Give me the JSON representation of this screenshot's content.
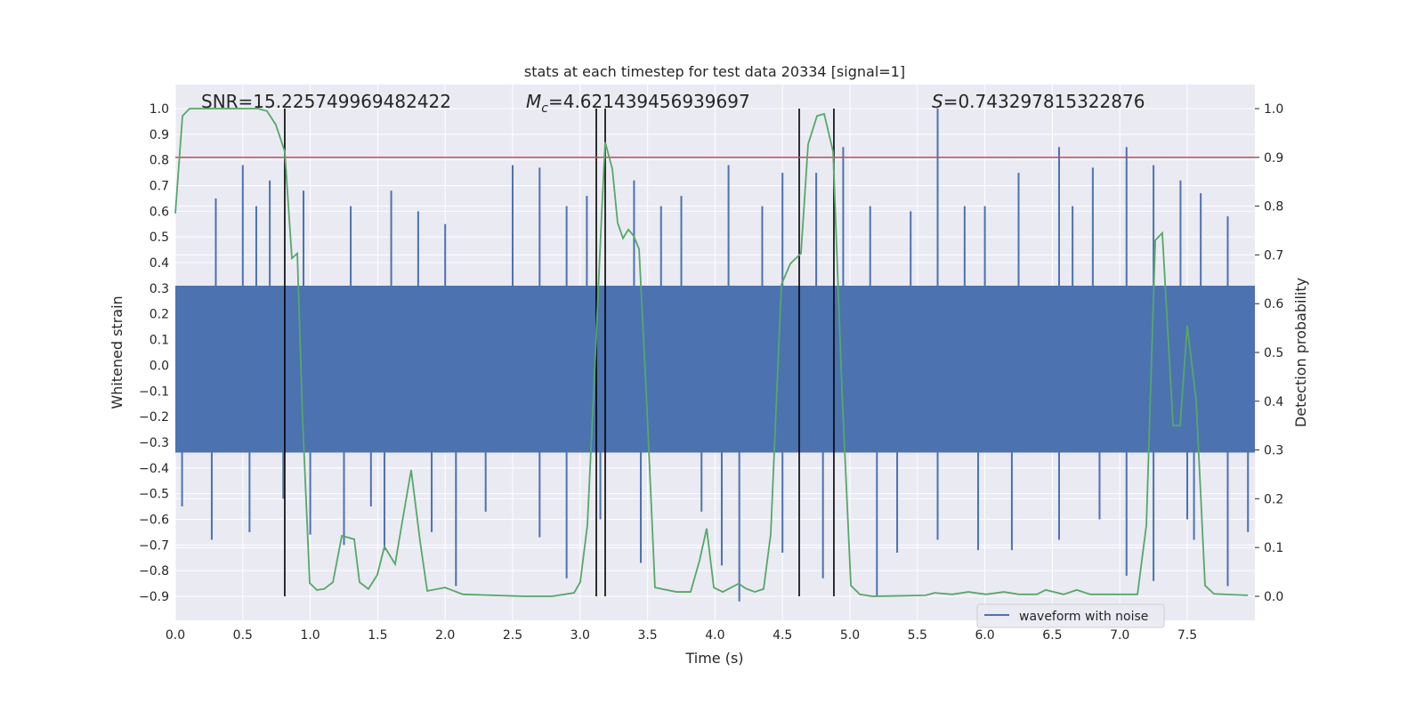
{
  "chart_data": {
    "type": "line",
    "title": "stats at each timestep for test data 20334 [signal=1]",
    "xlabel": "Time (s)",
    "ylabel": "Whitened strain",
    "ylabel_right": "Detection probability",
    "xlim": [
      0.0,
      8.0
    ],
    "ylim": [
      -0.99,
      1.09
    ],
    "ylim_right": [
      -0.05,
      1.05
    ],
    "grid": true,
    "legend_position": "lower-right",
    "x_ticks": [
      "0.0",
      "0.5",
      "1.0",
      "1.5",
      "2.0",
      "2.5",
      "3.0",
      "3.5",
      "4.0",
      "4.5",
      "5.0",
      "5.5",
      "6.0",
      "6.5",
      "7.0",
      "7.5"
    ],
    "y_ticks": [
      "1.0",
      "0.9",
      "0.8",
      "0.7",
      "0.6",
      "0.5",
      "0.4",
      "0.3",
      "0.2",
      "0.1",
      "0.0",
      "−0.1",
      "−0.2",
      "−0.3",
      "−0.4",
      "−0.5",
      "−0.6",
      "−0.7",
      "−0.8",
      "−0.9"
    ],
    "y_ticks_right": [
      "1.0",
      "0.9",
      "0.8",
      "0.7",
      "0.6",
      "0.5",
      "0.4",
      "0.3",
      "0.2",
      "0.1",
      "0.0"
    ],
    "annotations": {
      "snr": "SNR=15.225749969482422",
      "mc_symbol": "M",
      "mc_sub": "c",
      "mc_value": "=4.621439456939697",
      "s_symbol": "S",
      "s_value": "=0.743297815322876"
    },
    "colors": {
      "waveform": "#4c72b0",
      "probability": "#55a868",
      "threshold": "#c44e52",
      "markers": "#000000",
      "background": "#eaeaf2"
    },
    "waveform": {
      "name": "waveform with noise",
      "core_range": [
        -0.34,
        0.31
      ],
      "spikes": [
        [
          0.05,
          -0.55
        ],
        [
          0.27,
          -0.68
        ],
        [
          0.3,
          0.65
        ],
        [
          0.5,
          0.78
        ],
        [
          0.55,
          -0.65
        ],
        [
          0.6,
          0.62
        ],
        [
          0.7,
          0.72
        ],
        [
          0.8,
          -0.52
        ],
        [
          0.95,
          0.68
        ],
        [
          1.0,
          -0.66
        ],
        [
          1.25,
          -0.7
        ],
        [
          1.3,
          0.62
        ],
        [
          1.45,
          -0.55
        ],
        [
          1.55,
          -0.72
        ],
        [
          1.6,
          0.68
        ],
        [
          1.8,
          0.6
        ],
        [
          1.9,
          -0.65
        ],
        [
          2.0,
          0.55
        ],
        [
          2.08,
          -0.86
        ],
        [
          2.3,
          -0.57
        ],
        [
          2.5,
          0.78
        ],
        [
          2.7,
          0.77
        ],
        [
          2.7,
          -0.67
        ],
        [
          2.9,
          0.62
        ],
        [
          2.9,
          -0.83
        ],
        [
          3.05,
          0.66
        ],
        [
          3.15,
          -0.6
        ],
        [
          3.4,
          0.72
        ],
        [
          3.45,
          -0.77
        ],
        [
          3.6,
          0.62
        ],
        [
          3.75,
          0.66
        ],
        [
          3.9,
          -0.57
        ],
        [
          4.05,
          -0.78
        ],
        [
          4.1,
          0.78
        ],
        [
          4.18,
          -0.92
        ],
        [
          4.35,
          0.62
        ],
        [
          4.5,
          0.75
        ],
        [
          4.5,
          -0.73
        ],
        [
          4.75,
          0.75
        ],
        [
          4.8,
          -0.83
        ],
        [
          4.95,
          0.85
        ],
        [
          5.15,
          0.62
        ],
        [
          5.2,
          -0.9
        ],
        [
          5.35,
          -0.73
        ],
        [
          5.45,
          0.6
        ],
        [
          5.65,
          1.0
        ],
        [
          5.65,
          -0.68
        ],
        [
          5.85,
          0.62
        ],
        [
          5.95,
          -0.72
        ],
        [
          6.0,
          0.62
        ],
        [
          6.2,
          -0.72
        ],
        [
          6.25,
          0.75
        ],
        [
          6.55,
          0.85
        ],
        [
          6.55,
          -0.68
        ],
        [
          6.65,
          0.62
        ],
        [
          6.8,
          0.77
        ],
        [
          6.85,
          -0.6
        ],
        [
          7.05,
          0.85
        ],
        [
          7.05,
          -0.82
        ],
        [
          7.25,
          0.78
        ],
        [
          7.25,
          -0.84
        ],
        [
          7.45,
          0.72
        ],
        [
          7.5,
          -0.6
        ],
        [
          7.55,
          -0.68
        ],
        [
          7.6,
          0.67
        ],
        [
          7.8,
          0.58
        ],
        [
          7.8,
          -0.86
        ],
        [
          7.95,
          -0.65
        ]
      ]
    },
    "probability": {
      "axis": "right",
      "x": [
        0,
        0.053,
        0.106,
        0.613,
        0.679,
        0.745,
        0.811,
        0.864,
        0.904,
        0.943,
        0.996,
        1.049,
        1.102,
        1.168,
        1.234,
        1.326,
        1.365,
        1.431,
        1.497,
        1.55,
        1.629,
        1.682,
        1.748,
        1.814,
        1.867,
        1.999,
        2.131,
        2.592,
        2.79,
        2.955,
        3.001,
        3.054,
        3.107,
        3.16,
        3.186,
        3.239,
        3.278,
        3.318,
        3.358,
        3.397,
        3.437,
        3.49,
        3.555,
        3.714,
        3.819,
        3.885,
        3.938,
        3.991,
        4.057,
        4.175,
        4.228,
        4.294,
        4.36,
        4.413,
        4.492,
        4.558,
        4.637,
        4.69,
        4.756,
        4.809,
        4.875,
        4.941,
        5.007,
        5.073,
        5.165,
        5.561,
        5.627,
        5.759,
        5.877,
        6.009,
        6.141,
        6.253,
        6.385,
        6.451,
        6.583,
        6.682,
        6.781,
        7.131,
        7.197,
        7.263,
        7.315,
        7.355,
        7.395,
        7.447,
        7.5,
        7.566,
        7.632,
        7.698,
        7.949
      ],
      "y": [
        0.785,
        0.985,
        1.0,
        1.0,
        0.995,
        0.967,
        0.912,
        0.693,
        0.703,
        0.365,
        0.027,
        0.013,
        0.015,
        0.029,
        0.124,
        0.117,
        0.029,
        0.015,
        0.044,
        0.102,
        0.066,
        0.153,
        0.259,
        0.113,
        0.011,
        0.018,
        0.004,
        0,
        0,
        0.007,
        0.029,
        0.146,
        0.456,
        0.785,
        0.931,
        0.876,
        0.766,
        0.734,
        0.752,
        0.739,
        0.712,
        0.42,
        0.018,
        0.009,
        0.009,
        0.073,
        0.139,
        0.018,
        0.009,
        0.026,
        0.016,
        0.009,
        0.015,
        0.128,
        0.639,
        0.682,
        0.703,
        0.927,
        0.985,
        0.989,
        0.912,
        0.42,
        0.022,
        0.004,
        0,
        0.002,
        0.007,
        0.004,
        0.009,
        0.004,
        0.009,
        0.004,
        0.004,
        0.013,
        0.004,
        0.013,
        0.004,
        0.004,
        0.146,
        0.73,
        0.745,
        0.547,
        0.35,
        0.35,
        0.555,
        0.401,
        0.022,
        0.005,
        0.002
      ]
    },
    "threshold": {
      "axis": "right",
      "value": 0.9
    },
    "event_markers": [
      0.811,
      3.12,
      3.186,
      4.624,
      4.881
    ],
    "event_marker_range": [
      -0.9,
      1.0
    ]
  }
}
